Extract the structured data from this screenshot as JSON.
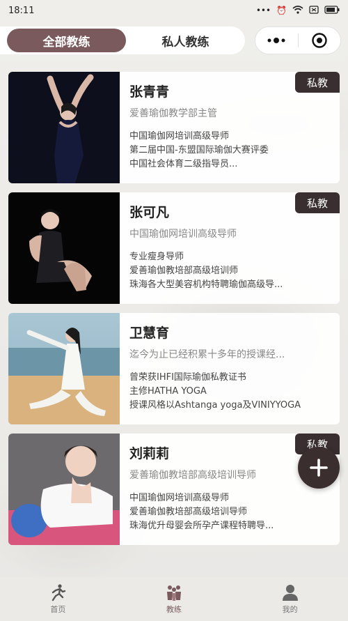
{
  "status": {
    "time": "18:11"
  },
  "tabs": [
    {
      "label": "全部教练",
      "active": true
    },
    {
      "label": "私人教练",
      "active": false
    }
  ],
  "capsule": {
    "more_icon": "more-dots-icon",
    "close_icon": "target-circle-icon"
  },
  "coaches": [
    {
      "name": "张青青",
      "title": "爱善瑜伽教学部主管",
      "desc": [
        "中国瑜伽网培训高级导师",
        "第二届中国-东盟国际瑜伽大赛评委",
        "中国社会体育二级指导员..."
      ],
      "badge": "私教"
    },
    {
      "name": "张可凡",
      "title": "中国瑜伽网培训高级导师",
      "desc": [
        "专业瘦身导师",
        "爱善瑜伽教培部高级培训师",
        "珠海各大型美容机构特聘瑜伽高级导..."
      ],
      "badge": "私教"
    },
    {
      "name": "卫慧育",
      "title": "迄今为止已经积累十多年的授课经...",
      "desc": [
        "曾荣获IHFI国际瑜伽私教证书",
        "主修HATHA YOGA",
        "授课风格以Ashtanga yoga及VINIYYOGA"
      ],
      "badge": ""
    },
    {
      "name": "刘莉莉",
      "title": "爱善瑜伽教培部高级培训导师",
      "desc": [
        "中国瑜伽网培训高级导师",
        "爱善瑜伽教培部高级培训导师",
        "珠海优升母婴会所孕产课程特聘导..."
      ],
      "badge": "私教"
    }
  ],
  "fab": {
    "icon": "plus-icon"
  },
  "nav": [
    {
      "label": "首页",
      "icon": "runner-icon",
      "active": false
    },
    {
      "label": "教练",
      "icon": "coach-group-icon",
      "active": true
    },
    {
      "label": "我的",
      "icon": "user-icon",
      "active": false
    }
  ]
}
